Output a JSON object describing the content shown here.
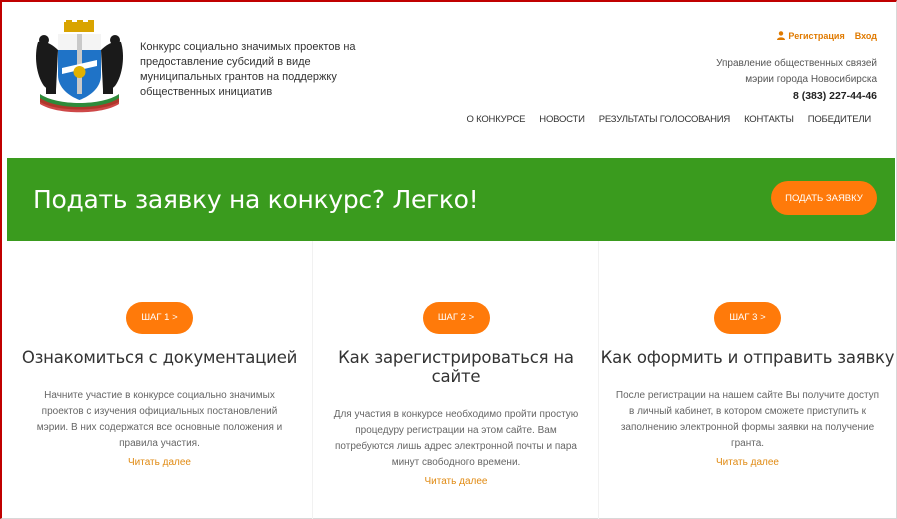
{
  "header": {
    "title": "Конкурс социально значимых проектов на предоставление субсидий в виде муниципальных грантов на поддержку общественных инициатив",
    "auth": {
      "register": "Регистрация",
      "login": "Вход"
    },
    "org_line1": "Управление общественных связей",
    "org_line2": "мэрии города Новосибирска",
    "phone": "8 (383) 227-44-46",
    "nav": [
      "О КОНКУРСЕ",
      "НОВОСТИ",
      "РЕЗУЛЬТАТЫ ГОЛОСОВАНИЯ",
      "КОНТАКТЫ",
      "ПОБЕДИТЕЛИ"
    ]
  },
  "banner": {
    "title": "Подать заявку на конкурс? Легко!",
    "cta": "ПОДАТЬ ЗАЯВКУ"
  },
  "steps": [
    {
      "badge": "ШАГ 1 >",
      "title": "Ознакомиться с документацией",
      "text": "Начните участие в конкурсе социально значимых проектов с изучения официальных постановлений мэрии. В них содержатся все основные положения и правила участия.",
      "more": "Читать далее"
    },
    {
      "badge": "ШАГ 2 >",
      "title": "Как зарегистрироваться на сайте",
      "text": "Для участия в конкурсе необходимо пройти простую процедуру регистрации на этом сайте. Вам потребуются лишь адрес электронной почты и пара минут свободного времени.",
      "more": "Читать далее"
    },
    {
      "badge": "ШАГ 3 >",
      "title": "Как оформить и отправить заявку",
      "text": "После регистрации на нашем сайте Вы получите доступ в личный кабинет, в котором сможете приступить к заполнению электронной формы заявки на получение гранта.",
      "more": "Читать далее"
    }
  ],
  "colors": {
    "banner_green": "#3a9b1e",
    "accent_orange": "#ff7a0a",
    "link_orange": "#e08a12"
  }
}
